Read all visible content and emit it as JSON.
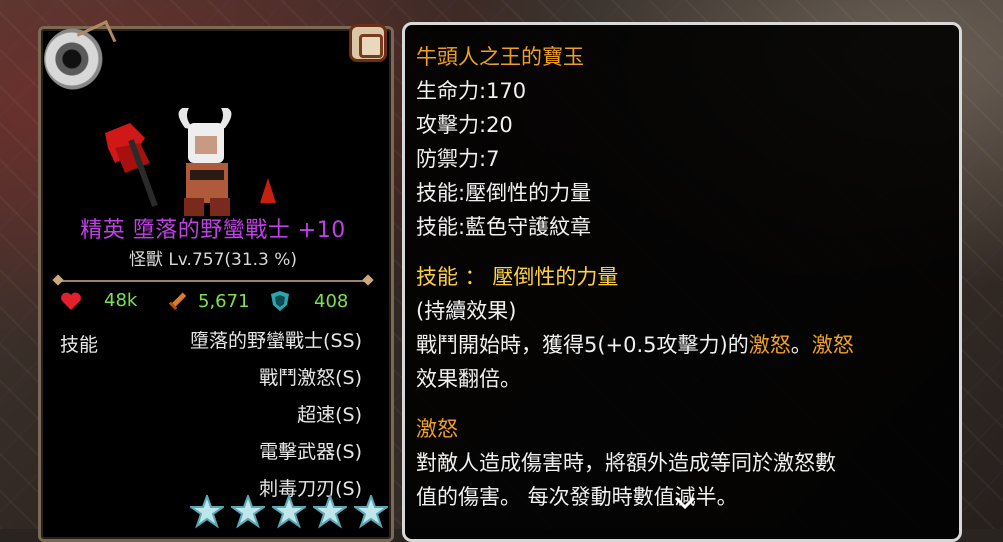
{
  "character": {
    "name": "精英 墮落的野蠻戰士 +10",
    "subtitle": "怪獸 Lv.757(31.3 %)",
    "stats": {
      "hp": "48k",
      "attack": "5,671",
      "defense": "408"
    },
    "skills_label": "技能",
    "skills": [
      "墮落的野蠻戰士(SS)",
      "戰鬥激怒(S)",
      "超速(S)",
      "電擊武器(S)",
      "刺毒刀刃(S)"
    ],
    "star_count": 5
  },
  "item": {
    "title": "牛頭人之王的寶玉",
    "lines": [
      "生命力:170",
      "攻擊力:20",
      "防禦力:7",
      "技能:壓倒性的力量",
      "技能:藍色守護紋章"
    ],
    "skill_heading": "技能 ： 壓倒性的力量",
    "effect_type": "(持續效果)",
    "effect_line1_a": "戰鬥開始時，獲得5(+0.5攻擊力)的",
    "effect_line1_b": "激怒",
    "effect_line1_c": "。",
    "effect_line1_d": "激怒",
    "effect_line2": "效果翻倍。",
    "keyword_heading": "激怒",
    "keyword_line1": "對敵人造成傷害時，將額外造成等同於激怒數",
    "keyword_line2": "值的傷害。 每次發動時數值減半。"
  },
  "colors": {
    "name_purple": "#c040e8",
    "item_title": "#f0a020",
    "skill_heading": "#ffd23c",
    "hp_heart": "#e0202c",
    "stat_green": "#7ee04e",
    "panel_border": "#d9d9d9"
  }
}
